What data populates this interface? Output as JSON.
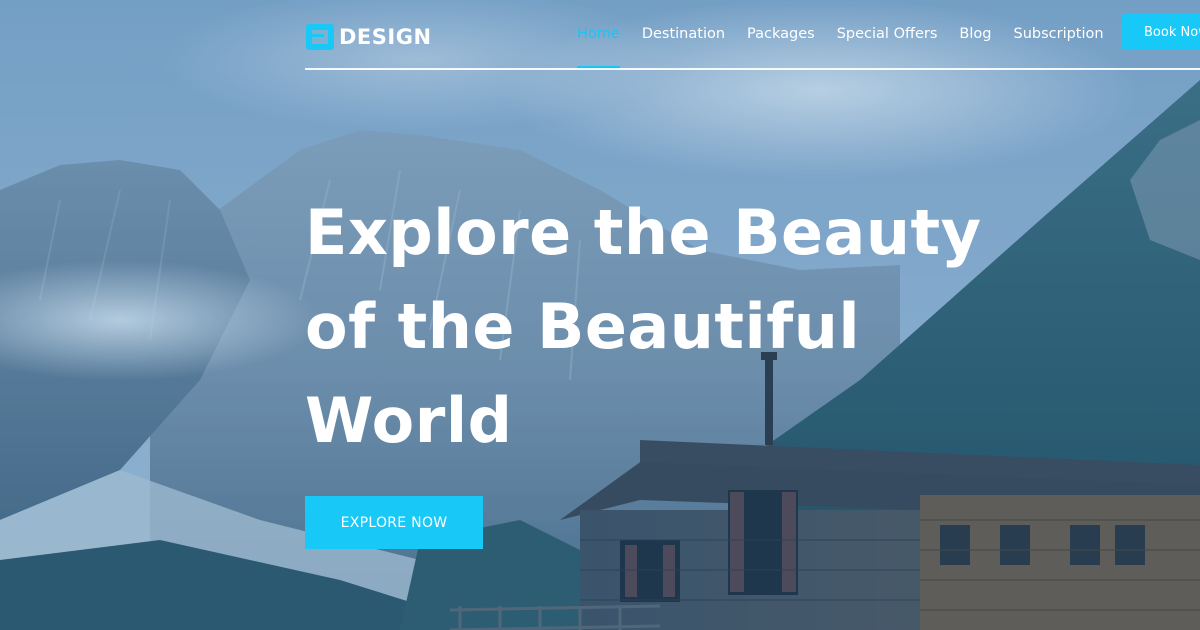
{
  "brand": {
    "logo_text": "DESIGN",
    "accent_color": "#18c8f6"
  },
  "nav": {
    "items": [
      {
        "label": "Home",
        "active": true
      },
      {
        "label": "Destination",
        "active": false
      },
      {
        "label": "Packages",
        "active": false
      },
      {
        "label": "Special Offers",
        "active": false
      },
      {
        "label": "Blog",
        "active": false
      },
      {
        "label": "Subscription",
        "active": false
      }
    ],
    "book_button": "Book Now"
  },
  "hero": {
    "title_lines": [
      "Explore the Beauty",
      "of the Beautiful",
      "World"
    ],
    "cta_label": "EXPLORE NOW",
    "background": "mountain-valley-cabin-photo"
  }
}
